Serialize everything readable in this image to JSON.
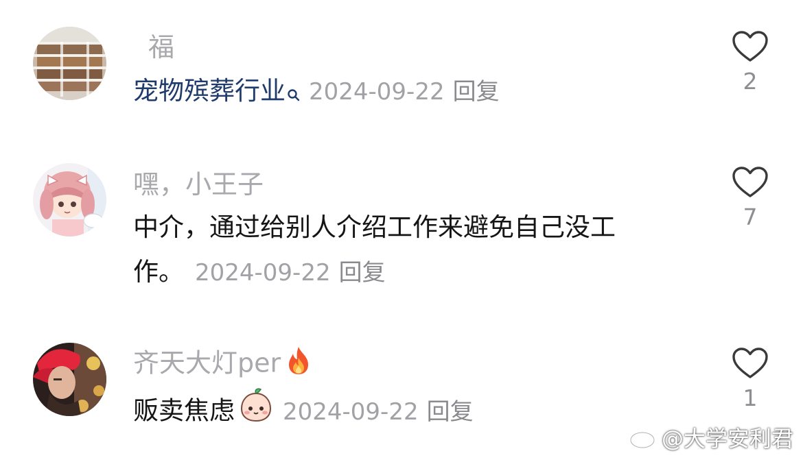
{
  "comments": [
    {
      "username": "福",
      "text": "宠物殡葬行业",
      "text_color": "#1f3b6b",
      "date": "2024-09-22",
      "reply": "回复",
      "likes": "2"
    },
    {
      "username": "嘿，小王子",
      "text_line1": "中介，通过给别人介绍工作来避免自己没工",
      "text_line2": "作。",
      "date": "2024-09-22",
      "reply": "回复",
      "likes": "7"
    },
    {
      "username": "齐天大灯per",
      "username_emoji": "fire",
      "text": "贩卖焦虑",
      "text_emoji": "peach-face",
      "date": "2024-09-22",
      "reply": "回复",
      "likes": "1"
    }
  ],
  "watermark": "@大学安利君",
  "icons": {
    "like": "heart-outline-icon",
    "search": "search-icon",
    "weibo": "weibo-logo-icon"
  }
}
